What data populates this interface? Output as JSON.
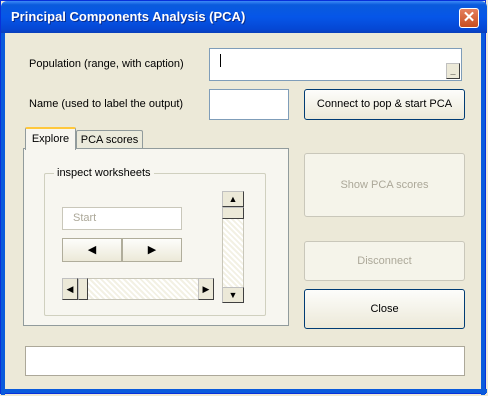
{
  "window": {
    "title": "Principal Components Analysis (PCA)"
  },
  "form": {
    "population_label": "Population (range, with caption)",
    "population_value": "",
    "name_label": "Name (used to label the output)",
    "name_value": "",
    "connect_button": "Connect to pop & start PCA"
  },
  "tabs": [
    {
      "label": "Explore",
      "active": true
    },
    {
      "label": "PCA scores",
      "active": false
    }
  ],
  "explore": {
    "group_label": "inspect worksheets",
    "start_field": "Start"
  },
  "buttons": {
    "show_pca_scores": "Show PCA scores",
    "disconnect": "Disconnect",
    "close": "Close"
  },
  "status": {
    "text": ""
  },
  "icons": {
    "close": "close-icon",
    "range_picker": "range-picker-icon",
    "left": "arrow-left-icon",
    "right": "arrow-right-icon",
    "up": "arrow-up-icon",
    "down": "arrow-down-icon"
  }
}
